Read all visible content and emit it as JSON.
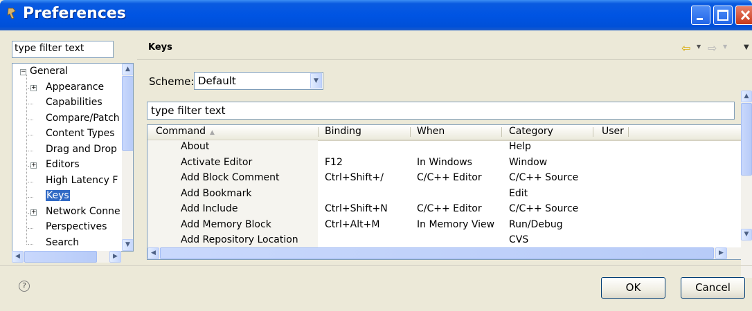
{
  "window": {
    "title": "Preferences"
  },
  "left": {
    "filter_text": "type filter text",
    "tree": [
      {
        "label": "General",
        "expander": "⊟",
        "level": 0
      },
      {
        "label": "Appearance",
        "expander": "⊞",
        "level": 1
      },
      {
        "label": "Capabilities",
        "expander": "",
        "level": 1
      },
      {
        "label": "Compare/Patch",
        "expander": "",
        "level": 1
      },
      {
        "label": "Content Types",
        "expander": "",
        "level": 1
      },
      {
        "label": "Drag and Drop",
        "expander": "",
        "level": 1
      },
      {
        "label": "Editors",
        "expander": "⊞",
        "level": 1
      },
      {
        "label": "High Latency F",
        "expander": "",
        "level": 1
      },
      {
        "label": "Keys",
        "expander": "",
        "level": 1,
        "selected": true
      },
      {
        "label": "Network Conne",
        "expander": "⊞",
        "level": 1
      },
      {
        "label": "Perspectives",
        "expander": "",
        "level": 1
      },
      {
        "label": "Search",
        "expander": "",
        "level": 1
      }
    ]
  },
  "right": {
    "page_title": "Keys",
    "scheme_label": "Scheme:",
    "scheme_value": "Default",
    "filter_text": "type filter text",
    "columns": [
      "Command",
      "Binding",
      "When",
      "Category",
      "User"
    ],
    "rows": [
      [
        "About",
        "",
        "",
        "Help",
        ""
      ],
      [
        "Activate Editor",
        "F12",
        "In Windows",
        "Window",
        ""
      ],
      [
        "Add Block Comment",
        "Ctrl+Shift+/",
        "C/C++ Editor",
        "C/C++ Source",
        ""
      ],
      [
        "Add Bookmark",
        "",
        "",
        "Edit",
        ""
      ],
      [
        "Add Include",
        "Ctrl+Shift+N",
        "C/C++ Editor",
        "C/C++ Source",
        ""
      ],
      [
        "Add Memory Block",
        "Ctrl+Alt+M",
        "In Memory View",
        "Run/Debug",
        ""
      ],
      [
        "Add Repository Location",
        "",
        "",
        "CVS",
        ""
      ]
    ]
  },
  "buttons": {
    "ok": "OK",
    "cancel": "Cancel"
  }
}
